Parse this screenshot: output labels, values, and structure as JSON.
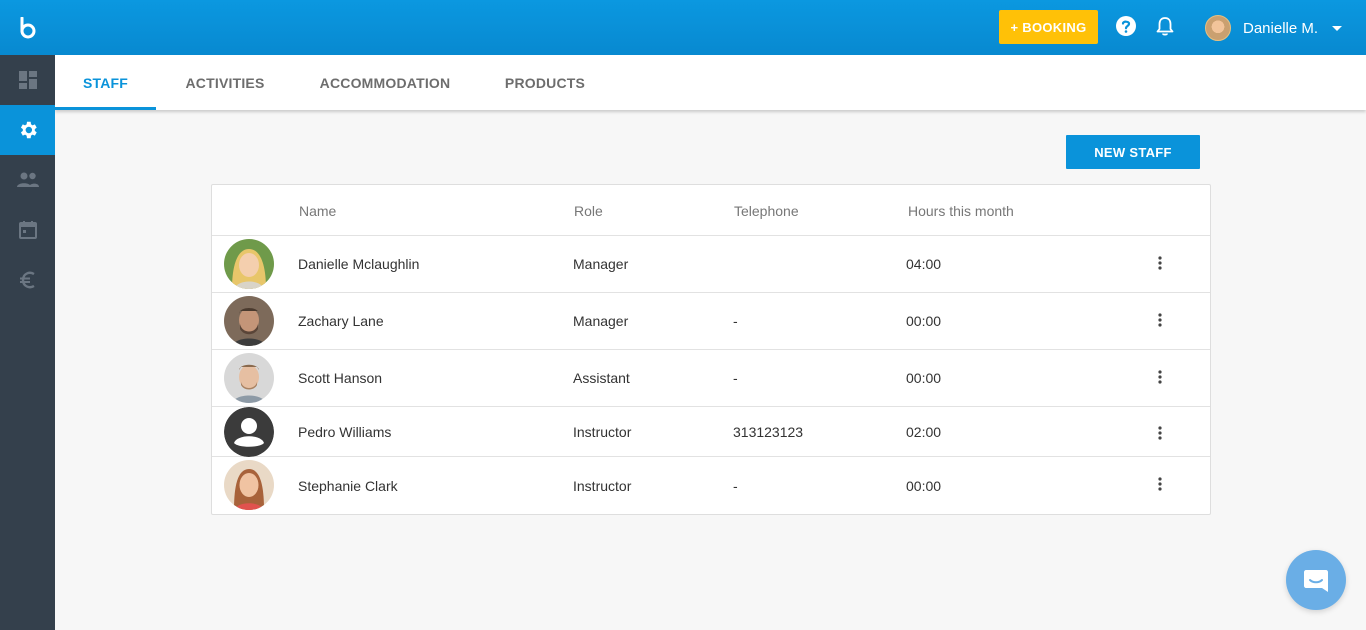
{
  "topbar": {
    "booking_label": "+ BOOKING",
    "user_name": "Danielle M.",
    "help_icon": "help-circle-icon",
    "notifications_icon": "bell-icon",
    "logo_icon": "app-logo-icon"
  },
  "sidebar": {
    "items": [
      {
        "name": "dashboard",
        "icon": "dashboard-icon"
      },
      {
        "name": "settings",
        "icon": "gear-icon",
        "active": true
      },
      {
        "name": "customers",
        "icon": "people-icon"
      },
      {
        "name": "calendar",
        "icon": "calendar-icon"
      },
      {
        "name": "payments",
        "icon": "euro-icon"
      }
    ]
  },
  "tabs": [
    {
      "label": "STAFF",
      "active": true
    },
    {
      "label": "ACTIVITIES"
    },
    {
      "label": "ACCOMMODATION"
    },
    {
      "label": "PRODUCTS"
    }
  ],
  "actions": {
    "new_staff_label": "NEW STAFF"
  },
  "table": {
    "columns": [
      "Name",
      "Role",
      "Telephone",
      "Hours this month"
    ],
    "rows": [
      {
        "name": "Danielle Mclaughlin",
        "role": "Manager",
        "telephone": "",
        "hours": "04:00",
        "avatar": "photo-blonde-woman"
      },
      {
        "name": "Zachary Lane",
        "role": "Manager",
        "telephone": "-",
        "hours": "00:00",
        "avatar": "photo-man"
      },
      {
        "name": "Scott Hanson",
        "role": "Assistant",
        "telephone": "-",
        "hours": "00:00",
        "avatar": "photo-man-light"
      },
      {
        "name": "Pedro Williams",
        "role": "Instructor",
        "telephone": "313123123",
        "hours": "02:00",
        "avatar": "default-user-icon"
      },
      {
        "name": "Stephanie Clark",
        "role": "Instructor",
        "telephone": "-",
        "hours": "00:00",
        "avatar": "photo-woman"
      }
    ]
  },
  "colors": {
    "primary": "#0a93da",
    "accent": "#ffc107",
    "sidebar": "#34404c",
    "chat": "#6aaee6"
  }
}
